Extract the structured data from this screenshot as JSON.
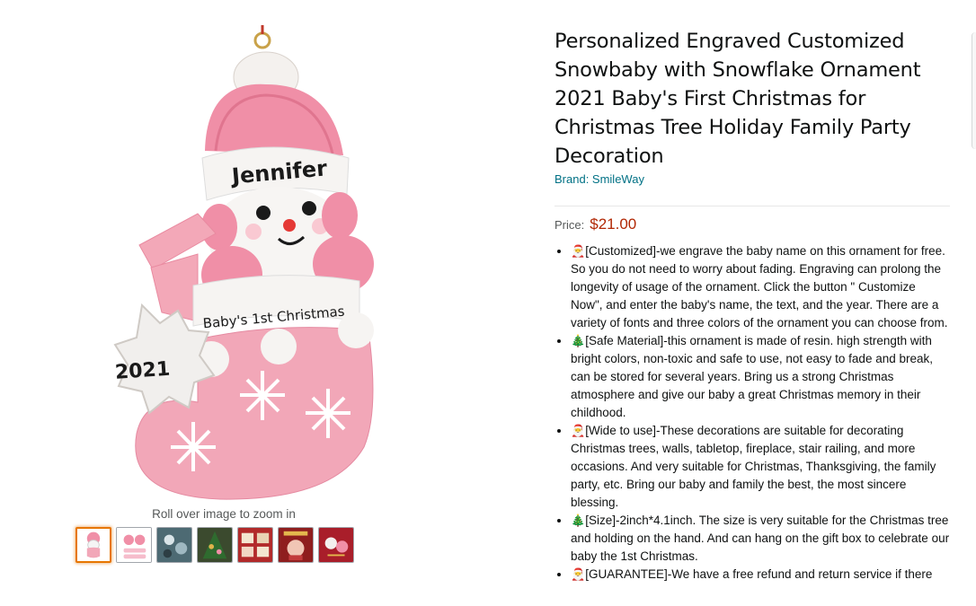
{
  "viewer": {
    "ornament_name": "Jennifer",
    "ornament_caption": "Baby's 1st Christmas",
    "ornament_year": "2021",
    "zoom_hint": "Roll over image to zoom in",
    "thumbnails": [
      {
        "name": "thumbnail-1",
        "selected": true
      },
      {
        "name": "thumbnail-2",
        "selected": false
      },
      {
        "name": "thumbnail-3",
        "selected": false
      },
      {
        "name": "thumbnail-4",
        "selected": false
      },
      {
        "name": "thumbnail-5",
        "selected": false
      },
      {
        "name": "thumbnail-6",
        "selected": false
      },
      {
        "name": "thumbnail-7",
        "selected": false
      }
    ]
  },
  "product": {
    "title": "Personalized Engraved Customized Snowbaby with Snowflake Ornament 2021 Baby's First Christmas for Christmas Tree Holiday Family Party Decoration",
    "brand": "Brand: SmileWay",
    "price_label": "Price:",
    "price": "$21.00",
    "bullets": [
      {
        "icon": "🎅",
        "text": "[Customized]-we engrave the baby name on this ornament for free. So you do not need to worry about fading. Engraving can prolong the longevity of usage of the ornament. Click the button \" Customize Now\", and enter the baby's name, the text, and the year. There are a variety of fonts and three colors of the ornament you can choose from."
      },
      {
        "icon": "🎄",
        "text": "[Safe Material]-this ornament is made of resin. high strength with bright colors, non-toxic and safe to use, not easy to fade and break, can be stored for several years. Bring us a strong Christmas atmosphere and give our baby a great Christmas memory in their childhood."
      },
      {
        "icon": "🎅",
        "text": "[Wide to use]-These decorations are suitable for decorating Christmas trees, walls, tabletop, fireplace, stair railing, and more occasions. And very suitable for Christmas, Thanksgiving, the family party, etc. Bring our baby and family the best, the most sincere blessing."
      },
      {
        "icon": "🎄",
        "text": "[Size]-2inch*4.1inch. The size is very suitable for the Christmas tree and holding on the hand. And can hang on the gift box to celebrate our baby the 1st Christmas."
      },
      {
        "icon": "🎅",
        "text": "[GUARANTEE]-We have a free refund and return service if there"
      }
    ]
  },
  "colors": {
    "link": "#007185",
    "price": "#b12704",
    "thumb_selected": "#e77600",
    "ornament_pink": "#f2a7b8"
  }
}
